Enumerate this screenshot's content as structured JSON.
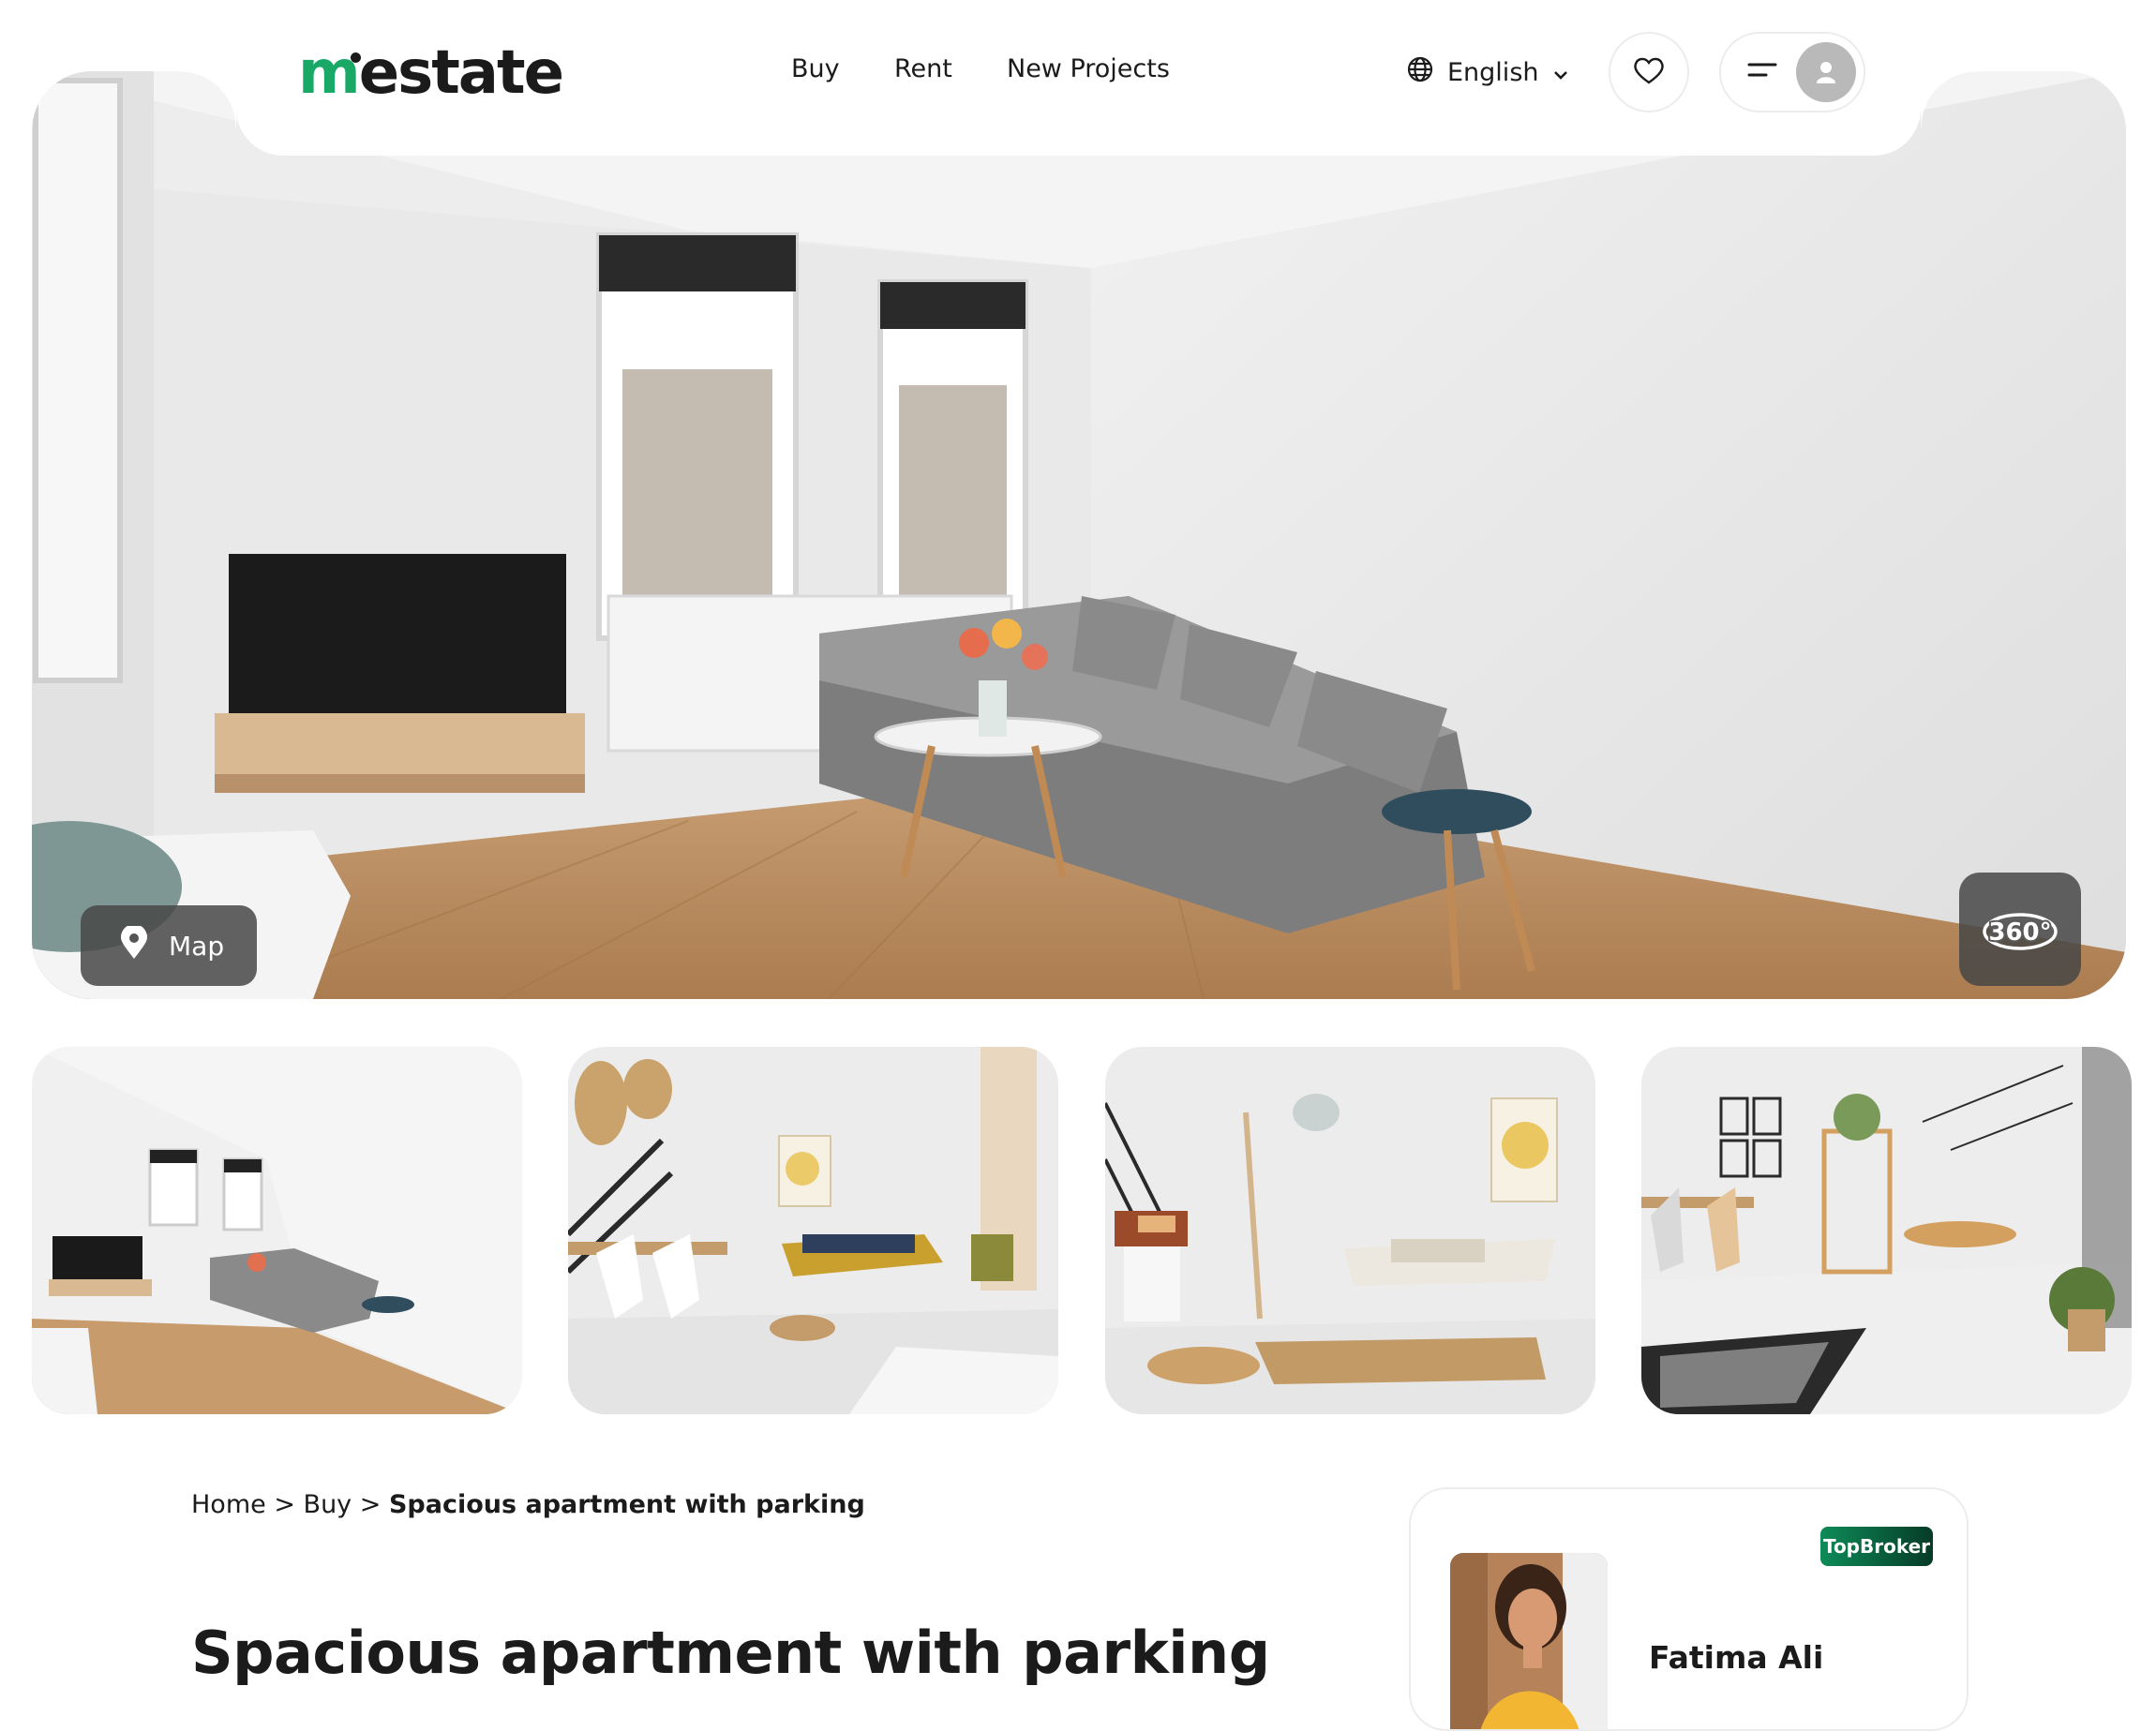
{
  "brand": {
    "logo_m": "m",
    "logo_rest": "estate",
    "accent": "#1aa867"
  },
  "nav": {
    "buy": "Buy",
    "rent": "Rent",
    "new_projects": "New Projects"
  },
  "language": {
    "label": "English",
    "icon": "globe-icon"
  },
  "header_buttons": {
    "favorites_icon": "heart-icon",
    "menu_icon": "menu-icon",
    "profile_icon": "user-avatar-icon"
  },
  "hero": {
    "map_label": "Map",
    "pano_label": "360°"
  },
  "breadcrumb": {
    "home": "Home",
    "buy": "Buy",
    "current": "Spacious apartment with parking",
    "separator": ">"
  },
  "listing": {
    "title": "Spacious apartment with parking"
  },
  "agent": {
    "badge": "TopBroker",
    "name": "Fatima Ali"
  }
}
